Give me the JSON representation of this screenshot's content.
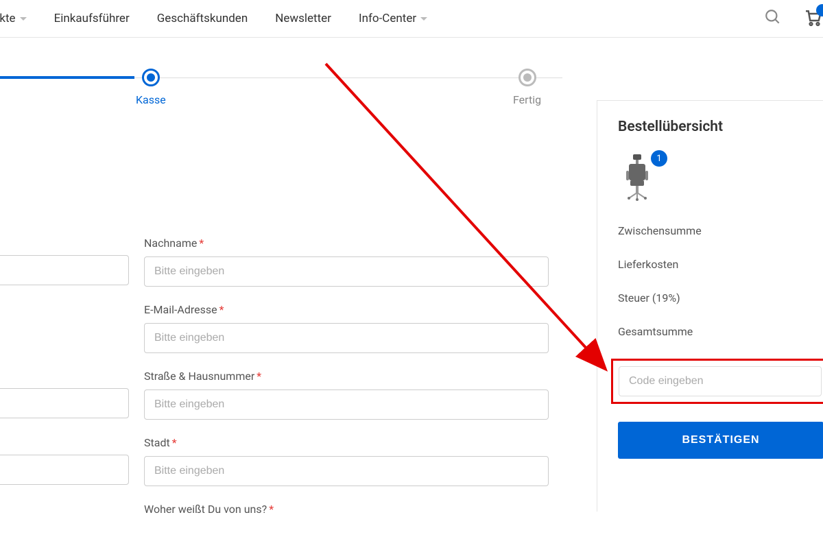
{
  "nav": {
    "items": [
      {
        "label": "ukte",
        "has_dropdown": true
      },
      {
        "label": "Einkaufsführer",
        "has_dropdown": false
      },
      {
        "label": "Geschäftskunden",
        "has_dropdown": false
      },
      {
        "label": "Newsletter",
        "has_dropdown": false
      },
      {
        "label": "Info-Center",
        "has_dropdown": true
      }
    ]
  },
  "progress": {
    "steps": {
      "kasse": "Kasse",
      "fertig": "Fertig"
    }
  },
  "form": {
    "lastname": {
      "label": "Nachname",
      "placeholder": "Bitte eingeben"
    },
    "email": {
      "label": "E-Mail-Adresse",
      "placeholder": "Bitte eingeben"
    },
    "street": {
      "label": "Straße & Hausnummer",
      "placeholder": "Bitte eingeben"
    },
    "city": {
      "label": "Stadt",
      "placeholder": "Bitte eingeben"
    },
    "referral": {
      "label": "Woher weißt Du von uns?"
    }
  },
  "summary": {
    "title": "Bestellübersicht",
    "qty": "1",
    "subtotal_label": "Zwischensumme",
    "shipping_label": "Lieferkosten",
    "tax_label": "Steuer (19%)",
    "total_label": "Gesamtsumme",
    "code_placeholder": "Code eingeben",
    "confirm_label": "BESTÄTIGEN"
  },
  "colors": {
    "primary": "#0066d6",
    "error": "#e30000"
  }
}
